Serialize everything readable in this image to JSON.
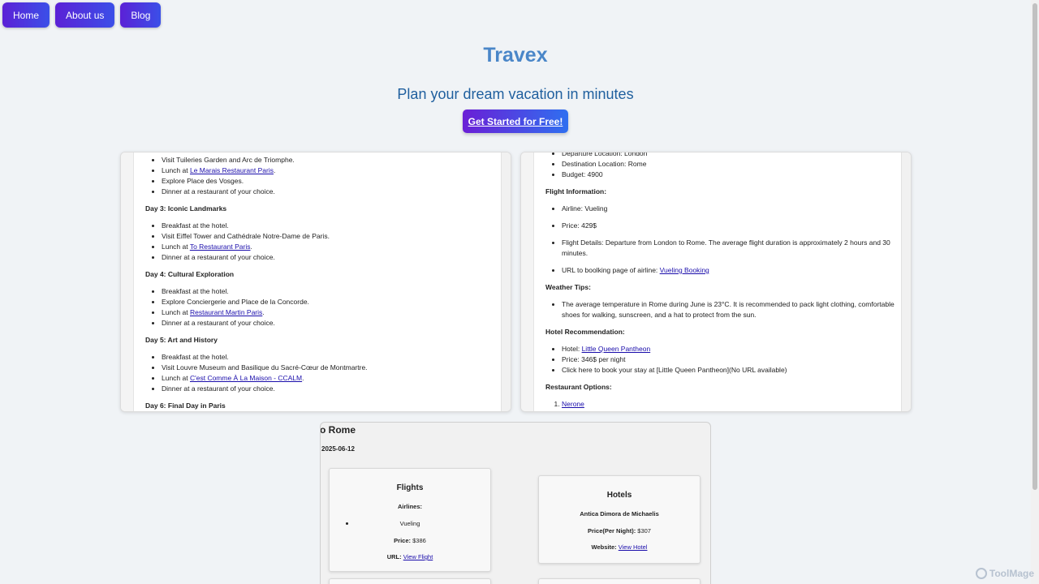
{
  "nav": {
    "items": [
      "Home",
      "About us",
      "Blog"
    ]
  },
  "hero": {
    "brand": "Travex",
    "tagline": "Plan your dream vacation in minutes",
    "cta": "Get Started for Free!"
  },
  "left_panel": {
    "intro_items": [
      {
        "text": "Visit Tuileries Garden and Arc de Triomphe."
      },
      {
        "pre": "Lunch at ",
        "link": "Le Marais Restaurant Paris",
        "post": "."
      },
      {
        "text": "Explore Place des Vosges."
      },
      {
        "text": "Dinner at a restaurant of your choice."
      }
    ],
    "days": [
      {
        "title": "Day 3: Iconic Landmarks",
        "items": [
          {
            "text": "Breakfast at the hotel."
          },
          {
            "text": "Visit Eiffel Tower and Cathédrale Notre-Dame de Paris."
          },
          {
            "pre": "Lunch at ",
            "link": "To Restaurant Paris",
            "post": "."
          },
          {
            "text": "Dinner at a restaurant of your choice."
          }
        ]
      },
      {
        "title": "Day 4: Cultural Exploration",
        "items": [
          {
            "text": "Breakfast at the hotel."
          },
          {
            "text": "Explore Conciergerie and Place de la Concorde."
          },
          {
            "pre": "Lunch at ",
            "link": "Restaurant Martin Paris",
            "post": "."
          },
          {
            "text": "Dinner at a restaurant of your choice."
          }
        ]
      },
      {
        "title": "Day 5: Art and History",
        "items": [
          {
            "text": "Breakfast at the hotel."
          },
          {
            "text": "Visit Louvre Museum and Basilique du Sacré-Cœur de Montmartre."
          },
          {
            "pre": "Lunch at ",
            "link": "C'est Comme À La Maison - CCALM",
            "post": "."
          },
          {
            "text": "Dinner at a restaurant of your choice."
          }
        ]
      },
      {
        "title": "Day 6: Final Day in Paris",
        "items": []
      }
    ]
  },
  "right_panel": {
    "top_items": [
      "Departure Location: London",
      "Destination Location: Rome",
      "Budget: 4900"
    ],
    "flight_title": "Flight Information:",
    "flight_items": [
      {
        "text": "Airline: Vueling"
      },
      {
        "text": "Price: 429$"
      },
      {
        "text": "Flight Details: Departure from London to Rome. The average flight duration is approximately 2 hours and 30 minutes."
      },
      {
        "pre": "URL to boolking page of airline: ",
        "link": "Vueling Booking",
        "post": ""
      }
    ],
    "weather_title": "Weather Tips:",
    "weather_items": [
      "The average temperature in Rome during June is 23°C. It is recommended to pack light clothing, comfortable shoes for walking, sunscreen, and a hat to protect from the sun."
    ],
    "hotel_title": "Hotel Recommendation:",
    "hotel_items": [
      {
        "pre": "Hotel: ",
        "link": "Little Queen Pantheon",
        "post": ""
      },
      {
        "text": "Price: 346$ per night"
      },
      {
        "text": "Click here to book your stay at [Little Queen Pantheon](No URL available)"
      }
    ],
    "restaurant_title": "Restaurant Options:",
    "restaurant_items": [
      "Nerone"
    ]
  },
  "trip": {
    "title": "o Rome",
    "date": "2025-06-12",
    "flights": {
      "title": "Flights",
      "airlines_label": "Airlines:",
      "airline": "Vueling",
      "price_label": "Price:",
      "price": " $386",
      "url_label": "URL:",
      "url_link": "View Flight"
    },
    "hotels": {
      "title": "Hotels",
      "name": "Antica Dimora de Michaelis",
      "price_label": "Price(Per Night):",
      "price": " $307",
      "website_label": "Website:",
      "website_link": "View Hotel"
    }
  },
  "watermark": "ToolMage"
}
